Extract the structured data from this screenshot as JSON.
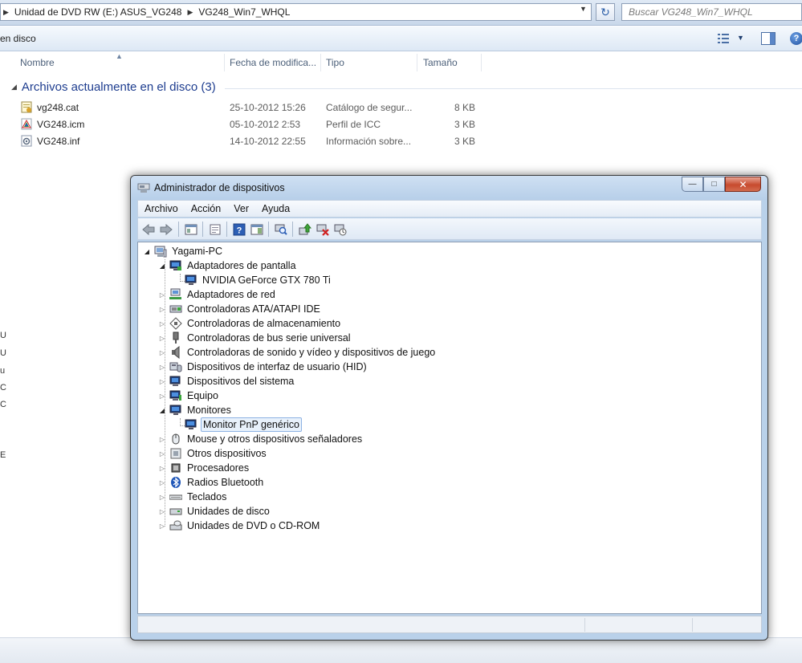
{
  "explorer": {
    "breadcrumbs": [
      "Unidad de DVD RW (E:) ASUS_VG248",
      "VG248_Win7_WHQL"
    ],
    "search_placeholder": "Buscar VG248_Win7_WHQL",
    "command_label": "en disco",
    "columns": [
      "Nombre",
      "Fecha de modifica...",
      "Tipo",
      "Tamaño"
    ],
    "group_title": "Archivos actualmente en el disco (3)",
    "files": [
      {
        "name": "vg248.cat",
        "date": "25-10-2012 15:26",
        "type": "Catálogo de segur...",
        "size": "8 KB",
        "icon": "catalog-file-icon"
      },
      {
        "name": "VG248.icm",
        "date": "05-10-2012 2:53",
        "type": "Perfil de ICC",
        "size": "3 KB",
        "icon": "color-profile-icon"
      },
      {
        "name": "VG248.inf",
        "date": "14-10-2012 22:55",
        "type": "Información sobre...",
        "size": "3 KB",
        "icon": "setup-info-icon"
      }
    ],
    "left_clipped_chars": [
      "U",
      "U",
      "u",
      "C",
      "C",
      "E"
    ]
  },
  "device_manager": {
    "title": "Administrador de dispositivos",
    "menu": [
      "Archivo",
      "Acción",
      "Ver",
      "Ayuda"
    ],
    "toolbar_icons": [
      "back-arrow-icon",
      "forward-arrow-icon",
      "show-hide-tree-icon",
      "properties-icon",
      "help-icon",
      "action-pane-icon",
      "scan-hardware-icon",
      "update-driver-icon",
      "uninstall-icon",
      "disable-device-icon"
    ],
    "tree": {
      "root": "Yagami-PC",
      "categories": [
        {
          "label": "Adaptadores de pantalla",
          "icon": "display-adapter-icon",
          "expanded": true,
          "children": [
            "NVIDIA GeForce GTX 780 Ti"
          ]
        },
        {
          "label": "Adaptadores de red",
          "icon": "network-adapter-icon"
        },
        {
          "label": "Controladoras ATA/ATAPI IDE",
          "icon": "ide-controller-icon"
        },
        {
          "label": "Controladoras de almacenamiento",
          "icon": "storage-controller-icon"
        },
        {
          "label": "Controladoras de bus serie universal",
          "icon": "usb-controller-icon"
        },
        {
          "label": "Controladoras de sonido y vídeo y dispositivos de juego",
          "icon": "sound-controller-icon"
        },
        {
          "label": "Dispositivos de interfaz de usuario (HID)",
          "icon": "hid-device-icon"
        },
        {
          "label": "Dispositivos del sistema",
          "icon": "system-device-icon"
        },
        {
          "label": "Equipo",
          "icon": "computer-icon"
        },
        {
          "label": "Monitores",
          "icon": "monitor-icon",
          "expanded": true,
          "children": [
            "Monitor PnP genérico"
          ]
        },
        {
          "label": "Mouse y otros dispositivos señaladores",
          "icon": "mouse-icon"
        },
        {
          "label": "Otros dispositivos",
          "icon": "other-devices-icon"
        },
        {
          "label": "Procesadores",
          "icon": "processor-icon"
        },
        {
          "label": "Radios Bluetooth",
          "icon": "bluetooth-icon"
        },
        {
          "label": "Teclados",
          "icon": "keyboard-icon"
        },
        {
          "label": "Unidades de disco",
          "icon": "disk-drive-icon"
        },
        {
          "label": "Unidades de DVD o CD-ROM",
          "icon": "dvd-drive-icon"
        }
      ],
      "selected": "Monitor PnP genérico"
    }
  },
  "colors": {
    "window_frame": "#b9d1ea",
    "group_title": "#1e3d8f",
    "selection_border": "#8db2e3",
    "close_button": "#c74a2e"
  }
}
